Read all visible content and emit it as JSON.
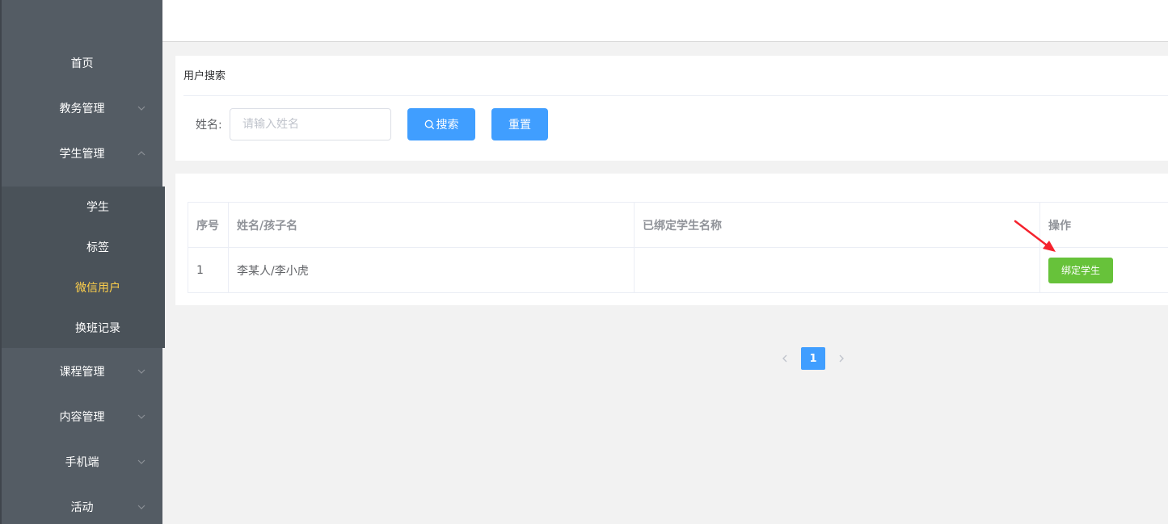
{
  "sidebar": {
    "items": [
      {
        "label": "首页"
      },
      {
        "label": "教务管理"
      },
      {
        "label": "学生管理"
      },
      {
        "label": "课程管理"
      },
      {
        "label": "内容管理"
      },
      {
        "label": "手机端"
      },
      {
        "label": "活动"
      }
    ],
    "sub_items": [
      {
        "label": "学生"
      },
      {
        "label": "标签"
      },
      {
        "label": "微信用户"
      },
      {
        "label": "换班记录"
      }
    ],
    "active_color": "#ffd04b",
    "bg_color": "#545c64"
  },
  "search": {
    "title": "用户搜索",
    "name_label": "姓名:",
    "name_placeholder": "请输入姓名",
    "search_button": "搜索",
    "reset_button": "重置"
  },
  "table": {
    "headers": [
      "序号",
      "姓名/孩子名",
      "已绑定学生名称",
      "操作"
    ],
    "rows": [
      {
        "index": "1",
        "name": "李某人/李小虎",
        "bound": "",
        "action": "绑定学生"
      }
    ]
  },
  "pagination": {
    "current": "1"
  },
  "colors": {
    "primary": "#409eff",
    "success": "#67c23a",
    "annotation": "#f5222d"
  }
}
